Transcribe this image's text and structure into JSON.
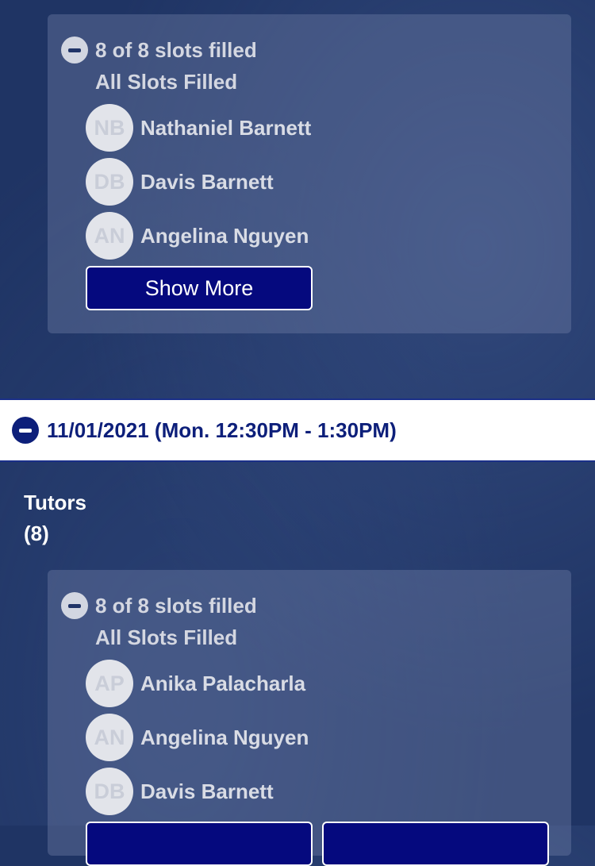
{
  "session_1": {
    "slots": "8 of 8 slots filled",
    "status": "All Slots Filled",
    "people": [
      {
        "initials": "NB",
        "name": "Nathaniel Barnett"
      },
      {
        "initials": "DB",
        "name": "Davis Barnett"
      },
      {
        "initials": "AN",
        "name": "Angelina Nguyen"
      }
    ],
    "show_more_label": "Show More"
  },
  "session_2": {
    "date_label": "11/01/2021 (Mon. 12:30PM - 1:30PM)",
    "tutors_label": "Tutors",
    "tutors_count": "(8)",
    "slots": "8 of 8 slots filled",
    "status": "All Slots Filled",
    "people": [
      {
        "initials": "AP",
        "name": "Anika Palacharla"
      },
      {
        "initials": "AN",
        "name": "Angelina Nguyen"
      },
      {
        "initials": "DB",
        "name": "Davis Barnett"
      }
    ]
  },
  "colors": {
    "background": "#1f3464",
    "button": "#05097e",
    "date_text": "#0d1f7a"
  },
  "icons": [
    "collapse-minus-icon"
  ]
}
